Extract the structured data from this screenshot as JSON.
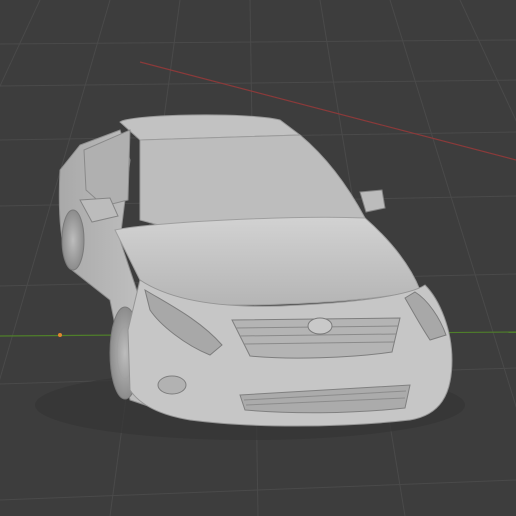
{
  "viewport": {
    "background": "#3d3d3d",
    "grid_color": "#494949",
    "axis_x_color": "#8a3a3a",
    "axis_y_color": "#4f7f2a",
    "origin_color": "#e0872d"
  },
  "model": {
    "name": "car-mesh",
    "body_color": "#c9c9c9",
    "shadow_color": "#9a9a9a",
    "dark_color": "#6f6f6f"
  }
}
